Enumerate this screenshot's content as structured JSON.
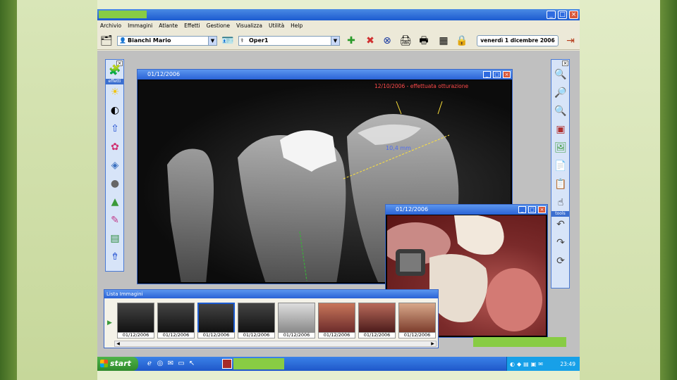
{
  "menu": [
    "Archivio",
    "Immagini",
    "Atlante",
    "Effetti",
    "Gestione",
    "Visualizza",
    "Utilità",
    "Help"
  ],
  "toolbar": {
    "patient_value": "Bianchi Mario",
    "operator_value": "Oper1",
    "date": "venerdì 1 dicembre 2006"
  },
  "left_panel": {
    "caption": "effetti",
    "icons": [
      "sun-icon",
      "contrast-icon",
      "histogram-icon",
      "color-icon",
      "emboss-icon",
      "sphere-icon",
      "landscape-icon",
      "filter-icon",
      "palette-icon",
      "sharpen-icon"
    ]
  },
  "right_panel": {
    "caption": "tools",
    "icons": [
      "zoom-in-icon",
      "zoom-out-icon",
      "zoom-fit-icon",
      "crop-icon",
      "image-icon",
      "document-icon",
      "clipboard-icon",
      "pointer-icon",
      "undo-icon",
      "redo-icon",
      "rotate-icon"
    ]
  },
  "xray_window": {
    "title": "01/12/2006",
    "annotation": "12/10/2006 - effettuata otturazione",
    "measurement": "10,4 mm"
  },
  "photo_window": {
    "title": "01/12/2006"
  },
  "image_list": {
    "title": "Lista Immagini",
    "thumbnails": [
      {
        "label": "01/12/2006"
      },
      {
        "label": "01/12/2006"
      },
      {
        "label": "01/12/2006"
      },
      {
        "label": "01/12/2006"
      },
      {
        "label": "01/12/2006"
      },
      {
        "label": "01/12/2006"
      },
      {
        "label": "01/12/2006"
      },
      {
        "label": "01/12/2006"
      }
    ]
  },
  "taskbar": {
    "start_label": "start",
    "clock": "23:49"
  }
}
